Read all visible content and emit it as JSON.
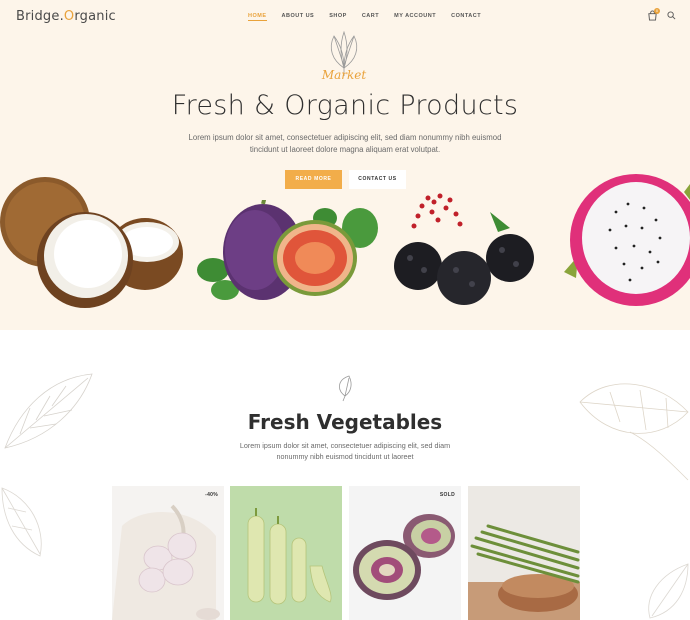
{
  "brand": {
    "name_prefix": "Bridge.",
    "name_o": "O",
    "name_suffix": "rganic"
  },
  "nav": [
    {
      "label": "HOME",
      "active": true
    },
    {
      "label": "ABOUT US",
      "active": false
    },
    {
      "label": "SHOP",
      "active": false
    },
    {
      "label": "CART",
      "active": false
    },
    {
      "label": "MY ACCOUNT",
      "active": false
    },
    {
      "label": "CONTACT",
      "active": false
    }
  ],
  "header_icons": {
    "cart": "shopping-bag-icon",
    "cart_count": "0",
    "search": "search-icon"
  },
  "hero": {
    "badge_text": "Market",
    "title": "Fresh & Organic Products",
    "text": "Lorem ipsum dolor sit amet, consectetuer adipiscing elit, sed diam nonummy nibh euismod tincidunt ut laoreet dolore magna aliquam erat volutpat.",
    "primary_button": "READ MORE",
    "secondary_button": "CONTACT US"
  },
  "section": {
    "title": "Fresh Vegetables",
    "text": "Lorem ipsum dolor sit amet, consectetuer adipiscing elit, sed diam nonummy nibh euismod tincidunt ut laoreet"
  },
  "products": [
    {
      "name": "garlic",
      "tag": "-40%"
    },
    {
      "name": "cucumbers",
      "tag": ""
    },
    {
      "name": "artichokes",
      "tag": "SOLD"
    },
    {
      "name": "asparagus",
      "tag": ""
    }
  ],
  "colors": {
    "accent": "#e9a23b",
    "hero_bg": "#fdf5ea",
    "button": "#f2ad4a"
  }
}
